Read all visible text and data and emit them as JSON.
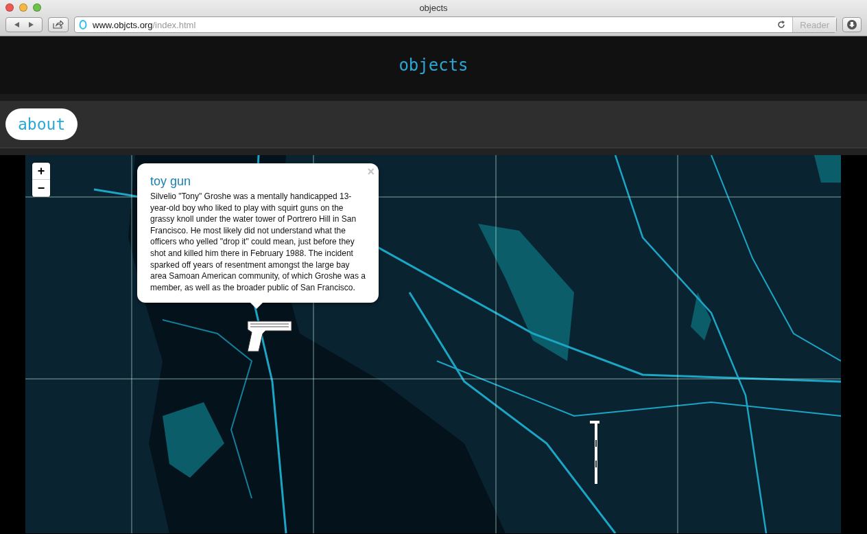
{
  "window": {
    "title": "objects"
  },
  "toolbar": {
    "url_host": "www.objcts.org",
    "url_path": "/index.html",
    "reader": "Reader",
    "reader_disabled": true
  },
  "site": {
    "title": "objects"
  },
  "nav": [
    {
      "label": "about",
      "selected": false
    }
  ],
  "map": {
    "zoom_in": "+",
    "zoom_out": "−",
    "popup": {
      "close": "×",
      "title": "toy gun",
      "text": "Silvelio \"Tony\" Groshe was a mentally handicapped 13-year-old boy who liked to play with squirt guns on the grassy knoll under the water tower of Portrero Hill in San Francisco. He most likely did not understand what the officers who yelled \"drop it\" could mean, just before they shot and killed him there in February 1988. The incident sparked off years of resentment amongst the large bay area Samoan American community, of which Groshe was a member, as well as the broader public of San Francisco."
    },
    "markers": [
      {
        "kind": "gun"
      },
      {
        "kind": "cane"
      }
    ]
  }
}
